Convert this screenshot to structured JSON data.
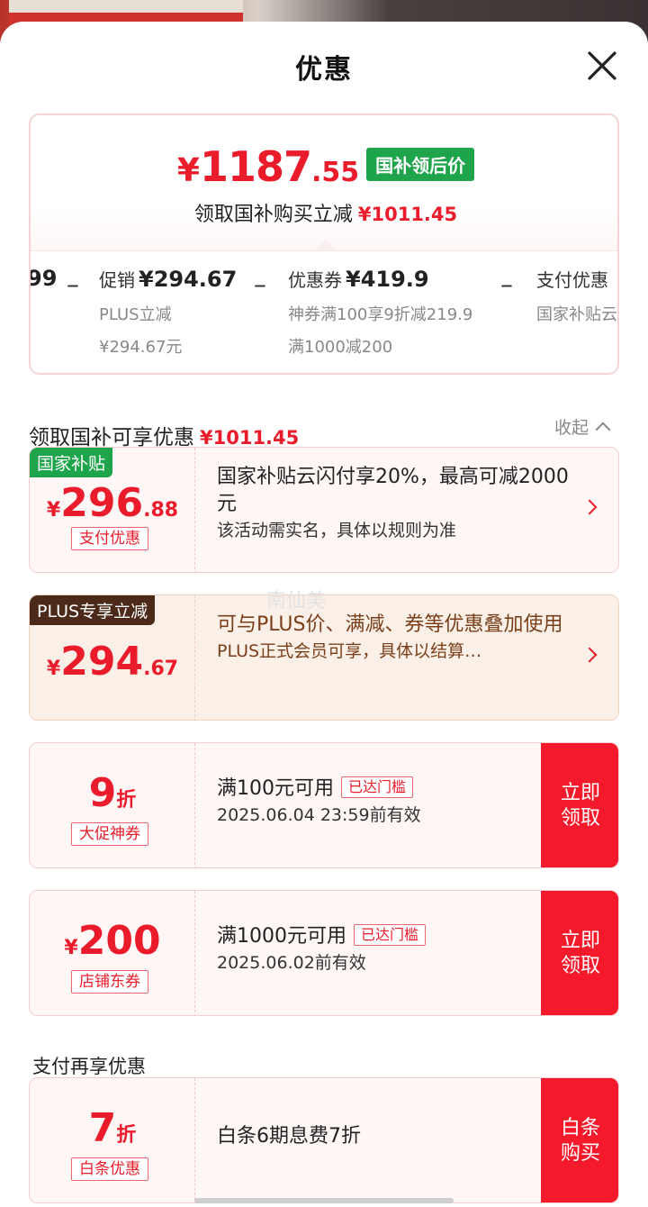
{
  "header": {
    "title": "优惠"
  },
  "summary": {
    "price_yen": "¥",
    "price_int": "1187",
    "price_dec": ".55",
    "price_tag": "国补领后价",
    "subtitle": "领取国补购买立减",
    "subtitle_amount": "¥1011.45",
    "breakdown": {
      "cut_left": "99",
      "items": [
        {
          "name": "促销",
          "amount": "¥294.67",
          "lines": [
            "PLUS立减",
            "¥294.67元"
          ]
        },
        {
          "name": "优惠券",
          "amount": "¥419.9",
          "lines": [
            "神券满100享9折减219.9",
            "满1000减200"
          ]
        },
        {
          "name": "支付优惠",
          "amount": "",
          "lines": [
            "国家补贴云"
          ]
        }
      ]
    }
  },
  "discounts": {
    "heading": "领取国补可享优惠",
    "heading_amount": "¥1011.45",
    "collapse_label": "收起"
  },
  "cards": [
    {
      "badge": "国家补贴",
      "badge_color": "#1ea44a",
      "yen": "¥",
      "int": "296",
      "dec": ".88",
      "chip": "支付优惠",
      "line1": "国家补贴云闪付享20%，最高可减2000元",
      "line2": "该活动需实名，具体以规则为准"
    },
    {
      "badge": "PLUS专享立减",
      "badge_color": "#4b2a1a",
      "yen": "¥",
      "int": "294",
      "dec": ".67",
      "chip": "",
      "line1": "可与PLUS价、满减、券等优惠叠加使用",
      "line2": "PLUS正式会员可享，具体以结算…"
    },
    {
      "int": "9",
      "unit": "折",
      "chip": "大促神券",
      "line1": "满100元可用",
      "reach": "已达门槛",
      "line2": "2025.06.04 23:59前有效",
      "button": "立即领取"
    },
    {
      "yen": "¥",
      "int": "200",
      "chip": "店铺东券",
      "line1": "满1000元可用",
      "reach": "已达门槛",
      "line2": "2025.06.02前有效",
      "button": "立即领取"
    }
  ],
  "pay_section": {
    "heading": "支付再享优惠",
    "card": {
      "int": "7",
      "unit": "折",
      "chip": "白条优惠",
      "line1": "白条6期息费7折",
      "button": "白条购买"
    }
  },
  "watermark": "南仙美",
  "colors": {
    "accent_red": "#ea1c2c",
    "green_badge": "#1ea44a",
    "plus_badge": "#4b2a1a",
    "button_red": "#f51a2b"
  },
  "icons": {
    "close": "close-icon",
    "chevron_right": "chevron-right-icon",
    "chevron_up": "chevron-up-icon"
  }
}
